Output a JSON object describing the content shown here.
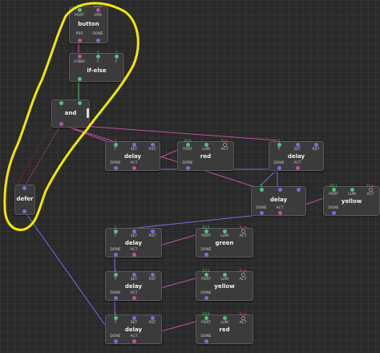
{
  "colors": {
    "pulse": "#7b6be0",
    "bool": "#c04fa3",
    "number": "#4fc37b",
    "annotation": "#f3e600",
    "true_value": "#e05555"
  },
  "button": {
    "title": "button",
    "in": [
      "PORT",
      "UPD"
    ],
    "out": [
      "PRS",
      "DONE"
    ],
    "vals": [
      "D9",
      "Loop"
    ]
  },
  "ifelse": {
    "title": "if-else",
    "in": [
      "COND",
      "T",
      "F"
    ],
    "vals": [
      "0",
      "1"
    ]
  },
  "and": {
    "title": "and"
  },
  "defer": {
    "title": "defer"
  },
  "delay": {
    "title": "delay",
    "in": [
      "T",
      "SET",
      "RST"
    ],
    "out": [
      "DONE",
      "ACT"
    ],
    "t_vals": [
      "1",
      "2",
      "3",
      "1",
      "2"
    ]
  },
  "red1": {
    "title": "red",
    "in": [
      "PORT",
      "LUM",
      "ACT"
    ],
    "out": [
      "DONE"
    ],
    "vals": [
      "D10",
      "True"
    ]
  },
  "yellow1": {
    "title": "yellow",
    "in": [
      "PORT",
      "LUM",
      "ACT"
    ],
    "out": [
      "DONE"
    ],
    "vals": [
      "D11",
      "True"
    ]
  },
  "green": {
    "title": "green",
    "in": [
      "PORT",
      "LUM",
      "ACT"
    ],
    "out": [
      "DONE"
    ],
    "vals": [
      "D12",
      "True"
    ]
  },
  "yellow2": {
    "title": "yellow",
    "in": [
      "PORT",
      "LUM",
      "ACT"
    ],
    "out": [
      "DONE"
    ],
    "vals": [
      "D11",
      "True"
    ]
  },
  "red2": {
    "title": "red",
    "in": [
      "PORT",
      "LUM",
      "ACT"
    ],
    "out": [
      "DONE"
    ],
    "vals": [
      "D10",
      "True"
    ]
  }
}
